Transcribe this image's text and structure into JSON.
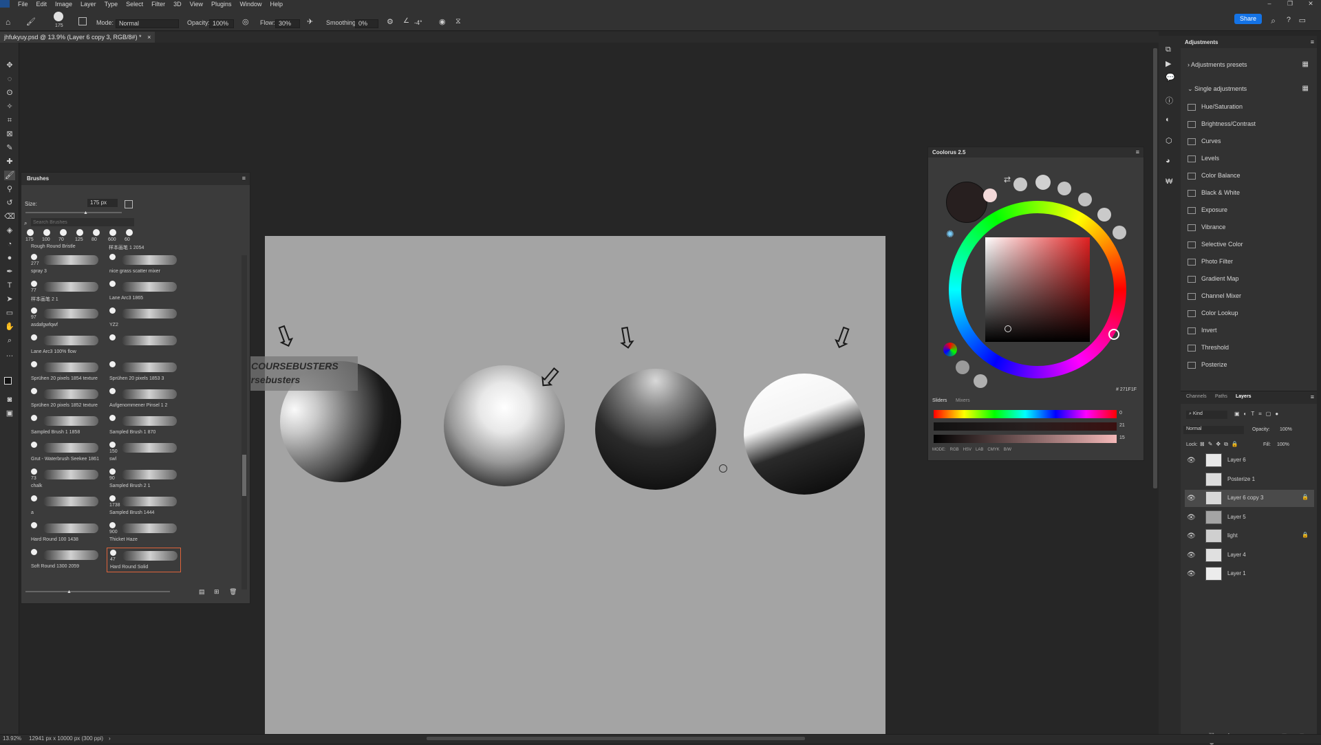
{
  "menu": [
    "File",
    "Edit",
    "Image",
    "Layer",
    "Type",
    "Select",
    "Filter",
    "3D",
    "View",
    "Plugins",
    "Window",
    "Help"
  ],
  "options": {
    "mode_label": "Mode:",
    "mode_value": "Normal",
    "opacity_label": "Opacity:",
    "opacity_value": "100%",
    "flow_label": "Flow:",
    "flow_value": "30%",
    "smoothing_label": "Smoothing:",
    "smoothing_value": "0%",
    "angle_value": "-4°",
    "brush_size": "175",
    "share": "Share"
  },
  "document_tab": "jhfukyuy.psd @ 13.9% (Layer 6 copy 3, RGB/8#) *",
  "watermark": {
    "line1": "This is a FREE course shared by COURSEBUSTERS",
    "line2": "Join us on telegram @coursebusters"
  },
  "brushes": {
    "title": "Brushes",
    "size_label": "Size:",
    "size_value": "175 px",
    "search_placeholder": "Search Brushes",
    "recent_sizes": [
      "175",
      "100",
      "70",
      "125",
      "80",
      "600",
      "60"
    ],
    "top_labels": [
      "Rough Round Bristle",
      "样本画笔 1 2054"
    ],
    "rows": [
      {
        "left": {
          "num": "277",
          "name": "spray 3"
        },
        "right": {
          "num": "",
          "name": "nice grass scatter mixer"
        }
      },
      {
        "left": {
          "num": "77",
          "name": "样本画笔 2 1"
        },
        "right": {
          "num": "",
          "name": "Lane Arc3 1865"
        }
      },
      {
        "left": {
          "num": "97",
          "name": "asdafgwfqwf"
        },
        "right": {
          "num": "",
          "name": "YZ2"
        }
      },
      {
        "left": {
          "num": "",
          "name": "Lane Arc3 100% flow"
        },
        "right": {
          "num": "",
          "name": ""
        }
      },
      {
        "left": {
          "num": "",
          "name": "Sprühen 20 pixels 1854 texture"
        },
        "right": {
          "num": "",
          "name": "Sprühen 20 pixels 1853 3"
        }
      },
      {
        "left": {
          "num": "",
          "name": "Sprühen 20 pixels 1852 texture"
        },
        "right": {
          "num": "",
          "name": "Aufgenommener Pinsel 1 2"
        }
      },
      {
        "left": {
          "num": "",
          "name": "Sampled Brush 1 1858"
        },
        "right": {
          "num": "",
          "name": "Sampled Brush 1 870"
        }
      },
      {
        "left": {
          "num": "",
          "name": "Grut - Waterbrush Seekee 1861"
        },
        "right": {
          "num": "150",
          "name": "swl"
        }
      },
      {
        "left": {
          "num": "73",
          "name": "chalk"
        },
        "right": {
          "num": "90",
          "name": "Sampled Brush 2 1"
        }
      },
      {
        "left": {
          "num": "",
          "name": "a"
        },
        "right": {
          "num": "1738",
          "name": "Sampled Brush 1444"
        }
      },
      {
        "left": {
          "num": "",
          "name": "Hard Round 100 1438"
        },
        "right": {
          "num": "900",
          "name": "Thicket Haze"
        }
      },
      {
        "left": {
          "num": "",
          "name": "Soft Round 1300 2059"
        },
        "right": {
          "num": "47",
          "name": "Hard Round Solid"
        }
      }
    ]
  },
  "coolorus": {
    "title": "Coolorus 2.5",
    "hex": "# 271F1F",
    "tabs": [
      "Sliders",
      "Mixers"
    ],
    "slider_values": [
      "0",
      "21",
      "15"
    ],
    "modes_label": "MODE:",
    "modes": [
      "RGB",
      "HSV",
      "LAB",
      "CMYK",
      "B/W"
    ]
  },
  "adjustments": {
    "title": "Adjustments",
    "presets": "Adjustments presets",
    "single": "Single adjustments",
    "items": [
      "Hue/Saturation",
      "Brightness/Contrast",
      "Curves",
      "Levels",
      "Color Balance",
      "Black & White",
      "Exposure",
      "Vibrance",
      "Selective Color",
      "Photo Filter",
      "Gradient Map",
      "Channel Mixer",
      "Color Lookup",
      "Invert",
      "Threshold",
      "Posterize"
    ]
  },
  "layers": {
    "tabs": [
      "Channels",
      "Paths",
      "Layers"
    ],
    "kind": "Kind",
    "blend": "Normal",
    "opacity_label": "Opacity:",
    "opacity_value": "100%",
    "lock_label": "Lock:",
    "fill_label": "Fill:",
    "fill_value": "100%",
    "items": [
      "Layer 6",
      "Posterize 1",
      "Layer 6 copy 3",
      "Layer 5",
      "light",
      "Layer 4",
      "Layer 1"
    ]
  },
  "status": {
    "zoom": "13.92%",
    "size": "12941 px x 10000 px (300 ppi)"
  }
}
